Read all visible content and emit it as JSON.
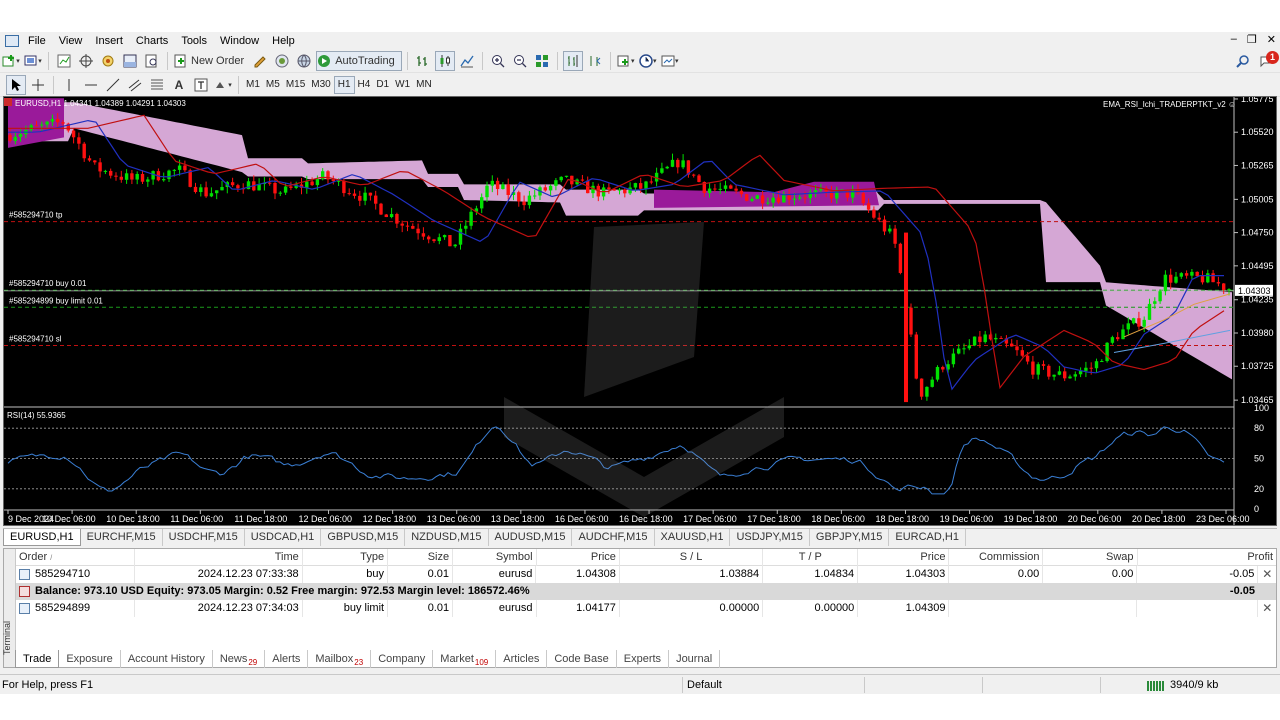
{
  "menu": [
    "File",
    "View",
    "Insert",
    "Charts",
    "Tools",
    "Window",
    "Help"
  ],
  "window_controls": [
    "‒",
    "❐",
    "✕"
  ],
  "toolbar": {
    "new_order": "New Order",
    "autotrading": "AutoTrading"
  },
  "timeframes": [
    "M1",
    "M5",
    "M15",
    "M30",
    "H1",
    "H4",
    "D1",
    "W1",
    "MN"
  ],
  "active_timeframe": "H1",
  "chart": {
    "symbol_header": "EURUSD,H1",
    "ohlc": "1.04341 1.04389 1.04291 1.04303",
    "indicator_name": "EMA_RSI_Ichi_TRADERPTKT_v2 ☺",
    "order_lines": {
      "tp": "#585294710 tp",
      "buy": "#585294710 buy 0.01",
      "buy_limit": "#585294899 buy limit 0.01",
      "sl": "#585294710 sl"
    },
    "price_ticks": [
      "1.05775",
      "1.05520",
      "1.05265",
      "1.05005",
      "1.04750",
      "1.04495",
      "1.04235",
      "1.03980",
      "1.03725",
      "1.03465"
    ],
    "current_price": "1.04303",
    "rsi_label": "RSI(14) 55.9365",
    "rsi_ticks": [
      "100",
      "80",
      "50",
      "20",
      "0"
    ],
    "time_ticks": [
      "9 Dec 2024",
      "10 Dec 06:00",
      "10 Dec 18:00",
      "11 Dec 06:00",
      "11 Dec 18:00",
      "12 Dec 06:00",
      "12 Dec 18:00",
      "13 Dec 06:00",
      "13 Dec 18:00",
      "16 Dec 06:00",
      "16 Dec 18:00",
      "17 Dec 06:00",
      "17 Dec 18:00",
      "18 Dec 06:00",
      "18 Dec 18:00",
      "19 Dec 06:00",
      "19 Dec 18:00",
      "20 Dec 06:00",
      "20 Dec 18:00",
      "23 Dec 06:00"
    ],
    "colors": {
      "bull": "#00e000",
      "bear": "#ff1010",
      "cloud_pink": "#e0b0e0",
      "cloud_purple": "#9a1a9a",
      "ema_fast": "#2030c0",
      "ema_slow": "#c01010",
      "rsi": "#3a7fd5"
    }
  },
  "symbol_tabs": [
    "EURUSD,H1",
    "EURCHF,M15",
    "USDCHF,M15",
    "USDCAD,H1",
    "GBPUSD,M15",
    "NZDUSD,M15",
    "AUDUSD,M15",
    "AUDCHF,M15",
    "XAUUSD,H1",
    "USDJPY,M15",
    "GBPJPY,M15",
    "EURCAD,H1"
  ],
  "terminal": {
    "side_label": "Terminal",
    "headers": [
      "Order",
      "Time",
      "Type",
      "Size",
      "Symbol",
      "Price",
      "S / L",
      "T / P",
      "Price",
      "Commission",
      "Swap",
      "Profit"
    ],
    "orders": [
      {
        "order": "585294710",
        "time": "2024.12.23 07:33:38",
        "type": "buy",
        "size": "0.01",
        "symbol": "eurusd",
        "price": "1.04308",
        "sl": "1.03884",
        "tp": "1.04834",
        "cur_price": "1.04303",
        "commission": "0.00",
        "swap": "0.00",
        "profit": "-0.05"
      },
      {
        "order": "585294899",
        "time": "2024.12.23 07:34:03",
        "type": "buy limit",
        "size": "0.01",
        "symbol": "eurusd",
        "price": "1.04177",
        "sl": "0.00000",
        "tp": "0.00000",
        "cur_price": "1.04309",
        "commission": "",
        "swap": "",
        "profit": ""
      }
    ],
    "balance_text": "Balance: 973.10 USD  Equity: 973.05  Margin: 0.52  Free margin: 972.53  Margin level: 186572.46%",
    "balance_profit": "-0.05",
    "tabs": [
      {
        "label": "Trade",
        "badge": ""
      },
      {
        "label": "Exposure",
        "badge": ""
      },
      {
        "label": "Account History",
        "badge": ""
      },
      {
        "label": "News",
        "badge": "29"
      },
      {
        "label": "Alerts",
        "badge": ""
      },
      {
        "label": "Mailbox",
        "badge": "23"
      },
      {
        "label": "Company",
        "badge": ""
      },
      {
        "label": "Market",
        "badge": "109"
      },
      {
        "label": "Articles",
        "badge": ""
      },
      {
        "label": "Code Base",
        "badge": ""
      },
      {
        "label": "Experts",
        "badge": ""
      },
      {
        "label": "Journal",
        "badge": ""
      }
    ]
  },
  "status": {
    "help": "For Help, press F1",
    "profile": "Default",
    "traffic": "3940/9 kb"
  },
  "notification_count": "1"
}
